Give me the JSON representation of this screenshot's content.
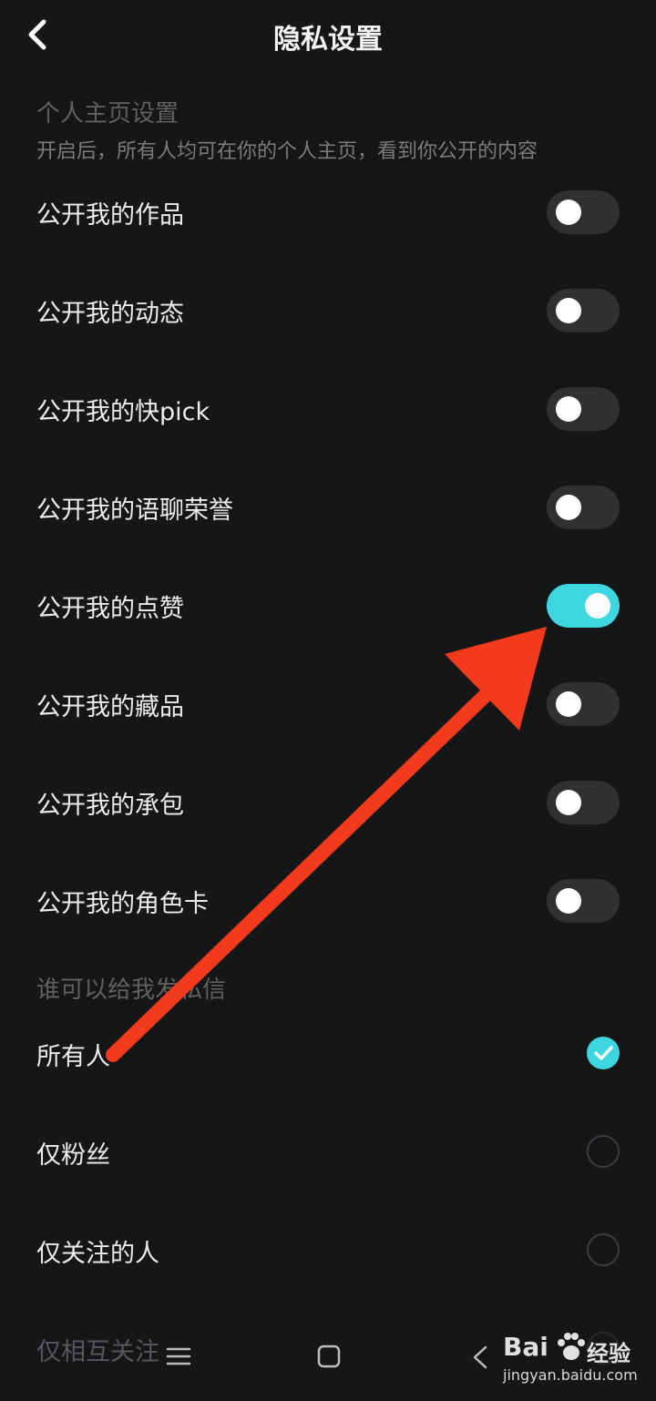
{
  "header": {
    "title": "隐私设置",
    "back_icon": "chevron-left-icon"
  },
  "section_homepage": {
    "title": "个人主页设置",
    "subtitle": "开启后，所有人均可在你的个人主页，看到你公开的内容"
  },
  "toggles": [
    {
      "label": "公开我的作品",
      "on": false
    },
    {
      "label": "公开我的动态",
      "on": false
    },
    {
      "label": "公开我的快pick",
      "on": false
    },
    {
      "label": "公开我的语聊荣誉",
      "on": false
    },
    {
      "label": "公开我的点赞",
      "on": true
    },
    {
      "label": "公开我的藏品",
      "on": false
    },
    {
      "label": "公开我的承包",
      "on": false
    },
    {
      "label": "公开我的角色卡",
      "on": false
    }
  ],
  "section_dm": {
    "title": "谁可以给我发私信"
  },
  "dm_options": [
    {
      "label": "所有人",
      "checked": true
    },
    {
      "label": "仅粉丝",
      "checked": false
    },
    {
      "label": "仅关注的人",
      "checked": false
    },
    {
      "label": "仅相互关注",
      "checked": false
    }
  ],
  "colors": {
    "accent": "#3ed6e0",
    "background": "#151617",
    "toggle_off": "#2e3032",
    "arrow": "#f23a1c"
  },
  "navbar": {
    "icons": [
      "menu-icon",
      "home-square-icon",
      "back-triangle-icon"
    ]
  },
  "watermark": {
    "brand": "Bai",
    "brand_cn": "经验",
    "url": "jingyan.baidu.com"
  }
}
